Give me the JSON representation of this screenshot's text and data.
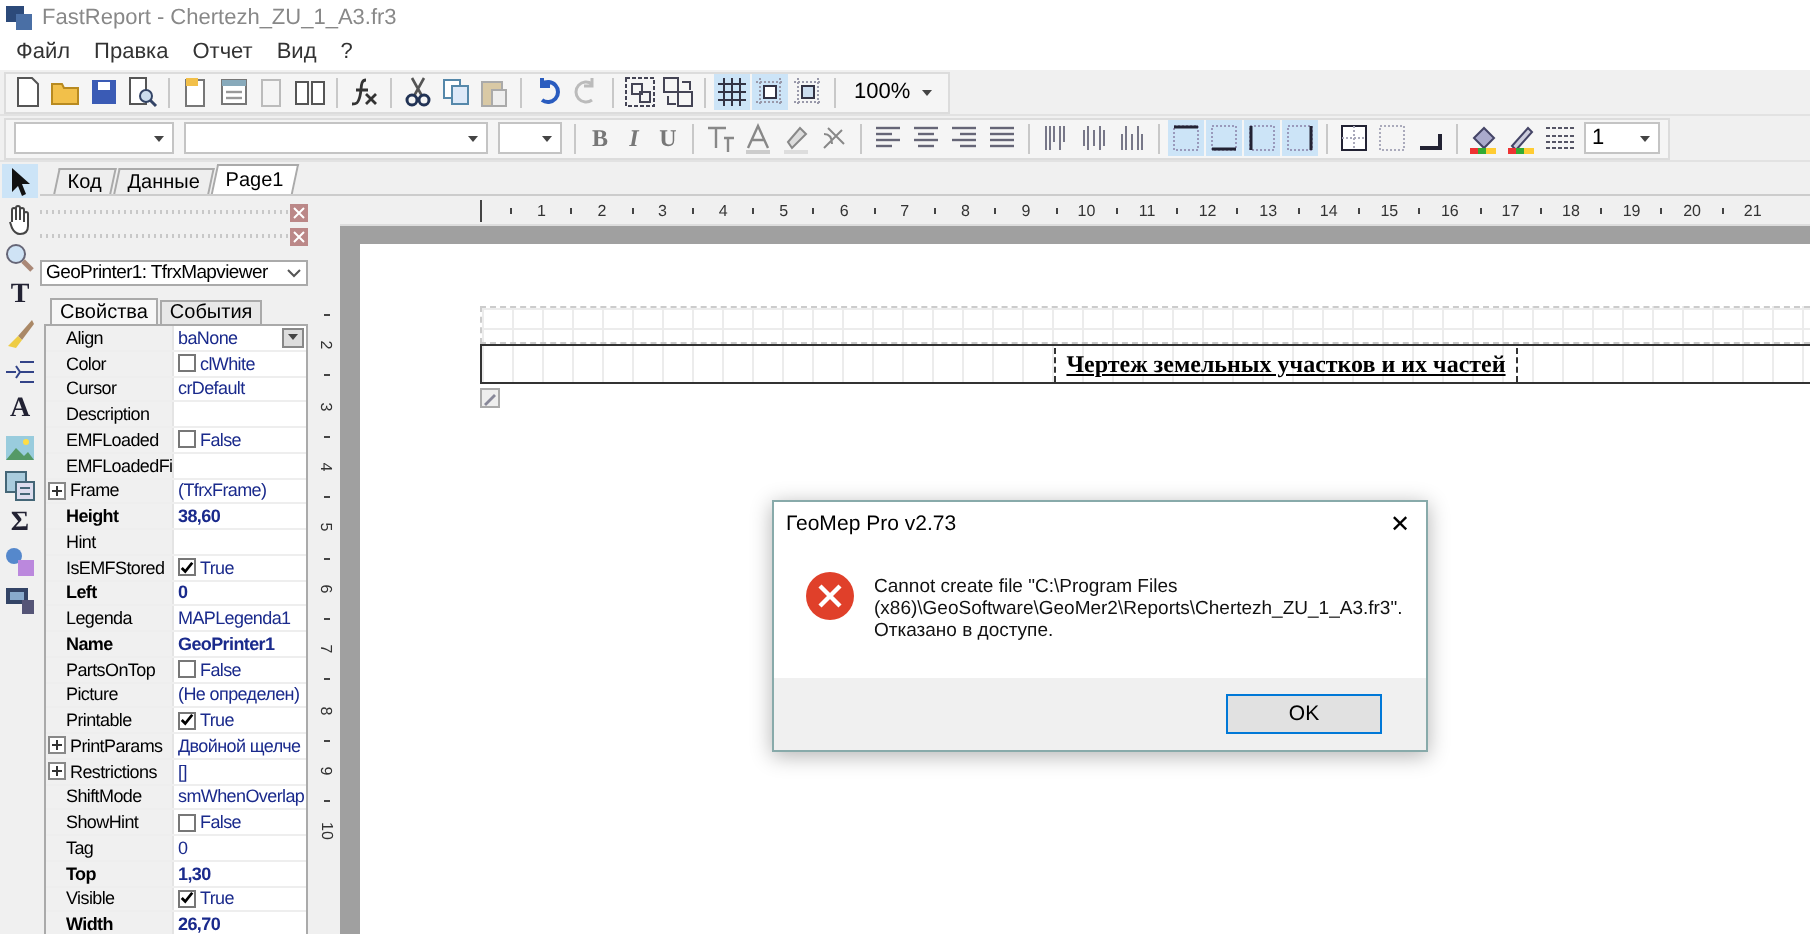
{
  "window": {
    "title": "FastReport - Chertezh_ZU_1_A3.fr3"
  },
  "menu": [
    "Файл",
    "Правка",
    "Отчет",
    "Вид",
    "?"
  ],
  "toolbar_main": [
    [
      {
        "kind": "new",
        "on": false
      },
      {
        "kind": "open",
        "on": false
      },
      {
        "kind": "save",
        "on": false
      },
      {
        "kind": "preview",
        "on": false
      }
    ],
    [
      {
        "kind": "page",
        "on": false
      },
      {
        "kind": "dialog",
        "on": false
      },
      {
        "kind": "delpage",
        "on": false
      },
      {
        "kind": "pagesetup",
        "on": false
      }
    ],
    [
      {
        "kind": "fx",
        "on": false
      }
    ],
    [
      {
        "kind": "cut",
        "on": false
      },
      {
        "kind": "copy",
        "on": false
      },
      {
        "kind": "paste",
        "on": false
      }
    ],
    [
      {
        "kind": "undo",
        "on": false
      },
      {
        "kind": "redo",
        "on": false
      }
    ],
    [
      {
        "kind": "group",
        "on": false
      },
      {
        "kind": "ungroup",
        "on": false
      }
    ],
    [
      {
        "kind": "grid",
        "on": true
      },
      {
        "kind": "snap",
        "on": true
      },
      {
        "kind": "fit",
        "on": false
      }
    ]
  ],
  "zoom": "100%",
  "toolbar_format": [
    [
      {
        "kind": "style-combo"
      },
      {
        "kind": "font-combo"
      },
      {
        "kind": "size-combo"
      }
    ],
    [
      {
        "kind": "letter",
        "label": "B",
        "on": false
      },
      {
        "kind": "letter",
        "label": "I",
        "on": false
      },
      {
        "kind": "letter",
        "label": "U",
        "on": false
      }
    ],
    [
      {
        "kind": "rotate",
        "on": false
      },
      {
        "kind": "fontcolor",
        "on": false
      },
      {
        "kind": "highlight",
        "on": false
      },
      {
        "kind": "format",
        "on": false
      }
    ],
    [
      {
        "kind": "alignleft",
        "on": false
      },
      {
        "kind": "aligncenter",
        "on": false
      },
      {
        "kind": "alignright",
        "on": false
      },
      {
        "kind": "justify",
        "on": false
      }
    ],
    [
      {
        "kind": "vtop",
        "on": false
      },
      {
        "kind": "vmiddle",
        "on": false
      },
      {
        "kind": "vbottom",
        "on": false
      }
    ],
    [
      {
        "kind": "ftop",
        "on": true
      },
      {
        "kind": "fbottom",
        "on": true
      },
      {
        "kind": "fleft",
        "on": true
      },
      {
        "kind": "fright",
        "on": true
      }
    ],
    [
      {
        "kind": "fall",
        "on": false
      },
      {
        "kind": "fnone",
        "on": false
      },
      {
        "kind": "shadow",
        "on": false
      }
    ],
    [
      {
        "kind": "fill",
        "on": false
      },
      {
        "kind": "framecolor",
        "on": false
      },
      {
        "kind": "linestyle",
        "on": false
      },
      {
        "kind": "width-combo",
        "value": "1"
      }
    ]
  ],
  "tools": [
    {
      "kind": "pointer",
      "selected": true
    },
    {
      "kind": "hand",
      "selected": false
    },
    {
      "kind": "magnifier",
      "selected": false
    },
    {
      "kind": "letter",
      "label": "T",
      "selected": false
    },
    {
      "kind": "brush",
      "selected": false
    },
    {
      "kind": "band",
      "selected": false
    },
    {
      "kind": "letter",
      "label": "A",
      "selected": false
    },
    {
      "kind": "picture",
      "selected": false
    },
    {
      "kind": "table",
      "selected": false
    },
    {
      "kind": "letter",
      "label": "Σ",
      "selected": false
    },
    {
      "kind": "shapes",
      "selected": false
    },
    {
      "kind": "computer",
      "selected": false
    }
  ],
  "tabs": [
    {
      "label": "Код",
      "selected": false
    },
    {
      "label": "Данные",
      "selected": false
    },
    {
      "label": "Page1",
      "selected": true
    }
  ],
  "inspector": {
    "object": "GeoPrinter1: TfrxMapviewer",
    "tabs": [
      {
        "label": "Свойства",
        "selected": true
      },
      {
        "label": "События",
        "selected": false
      }
    ],
    "rows": [
      {
        "name": "Align",
        "value": "baNone",
        "kind": "dropdown",
        "bold": false,
        "expandable": false
      },
      {
        "name": "Color",
        "value": "clWhite",
        "kind": "check",
        "checked": false,
        "bold": false,
        "expandable": false
      },
      {
        "name": "Cursor",
        "value": "crDefault",
        "kind": "text",
        "bold": false,
        "expandable": false
      },
      {
        "name": "Description",
        "kind": "text",
        "bold": false,
        "expandable": false
      },
      {
        "name": "EMFLoaded",
        "value": "False",
        "kind": "check",
        "checked": false,
        "bold": false,
        "expandable": false
      },
      {
        "name": "EMFLoadedFi",
        "kind": "text",
        "bold": false,
        "expandable": false
      },
      {
        "name": "Frame",
        "value": "(TfrxFrame)",
        "kind": "text",
        "bold": false,
        "expandable": true
      },
      {
        "name": "Height",
        "value": "38,60",
        "kind": "text",
        "bold": true,
        "expandable": false
      },
      {
        "name": "Hint",
        "kind": "text",
        "bold": false,
        "expandable": false
      },
      {
        "name": "IsEMFStored",
        "value": "True",
        "kind": "check",
        "checked": true,
        "bold": false,
        "expandable": false
      },
      {
        "name": "Left",
        "value": "0",
        "kind": "text",
        "bold": true,
        "expandable": false
      },
      {
        "name": "Legenda",
        "value": "MAPLegenda1",
        "kind": "text",
        "bold": false,
        "expandable": false
      },
      {
        "name": "Name",
        "value": "GeoPrinter1",
        "kind": "text",
        "bold": true,
        "expandable": false
      },
      {
        "name": "PartsOnTop",
        "value": "False",
        "kind": "check",
        "checked": false,
        "bold": false,
        "expandable": false
      },
      {
        "name": "Picture",
        "value": "(Не определен)",
        "kind": "text",
        "bold": false,
        "expandable": false
      },
      {
        "name": "Printable",
        "value": "True",
        "kind": "check",
        "checked": true,
        "bold": false,
        "expandable": false
      },
      {
        "name": "PrintParams",
        "value": "Двойной щелче",
        "kind": "text",
        "bold": false,
        "expandable": true
      },
      {
        "name": "Restrictions",
        "value": "[]",
        "kind": "text",
        "bold": false,
        "expandable": true
      },
      {
        "name": "ShiftMode",
        "value": "smWhenOverlap",
        "kind": "text",
        "bold": false,
        "expandable": false
      },
      {
        "name": "ShowHint",
        "value": "False",
        "kind": "check",
        "checked": false,
        "bold": false,
        "expandable": false
      },
      {
        "name": "Tag",
        "value": "0",
        "kind": "text",
        "bold": false,
        "expandable": false
      },
      {
        "name": "Top",
        "value": "1,30",
        "kind": "text",
        "bold": true,
        "expandable": false
      },
      {
        "name": "Visible",
        "value": "True",
        "kind": "check",
        "checked": true,
        "bold": false,
        "expandable": false
      },
      {
        "name": "Width",
        "value": "26,70",
        "kind": "text",
        "bold": true,
        "expandable": false
      }
    ]
  },
  "rulers": {
    "horizontal": [
      "1",
      "2",
      "3",
      "4",
      "5",
      "6",
      "7",
      "8",
      "9",
      "10",
      "11",
      "12",
      "13",
      "14",
      "15",
      "16",
      "17",
      "18",
      "19",
      "20",
      "21"
    ],
    "vertical": [
      "2",
      "3",
      "4",
      "5",
      "6",
      "7",
      "8",
      "9",
      "10"
    ]
  },
  "report": {
    "band_title": "Чертеж земельных участков и их частей"
  },
  "dialog": {
    "title": "ГеоМер Pro v2.73",
    "close": "✕",
    "message_lines": [
      "Cannot create file \"C:\\Program Files",
      "(x86)\\GeoSoftware\\GeoMer2\\Reports\\Chertezh_ZU_1_A3.fr3\".",
      "Отказано в доступе."
    ],
    "button": "OK"
  }
}
